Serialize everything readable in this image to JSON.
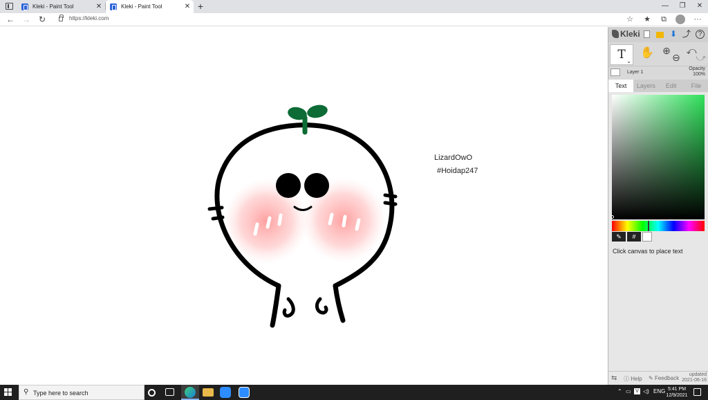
{
  "browser": {
    "tabs": [
      {
        "title": "Kleki - Paint Tool",
        "close": "✕"
      },
      {
        "title": "Kleki - Paint Tool",
        "close": "✕"
      }
    ],
    "new_tab": "+",
    "window_controls": [
      "—",
      "❐",
      "✕"
    ],
    "back": "←",
    "forward": "→",
    "reload": "↻",
    "url": "https://kleki.com",
    "toolbar_icons": [
      "add-favorite-icon",
      "favorites-icon",
      "collections-icon",
      "profile-icon",
      "more-icon"
    ],
    "more": "···"
  },
  "canvas": {
    "text_line_1": "LizardOwO",
    "text_line_2": "#Hoidap247"
  },
  "kleki_panel": {
    "logo": "Kleki",
    "text_tool": "T",
    "layer_name": "Layer 1",
    "opacity_label": "Opacity",
    "opacity_value": "100%",
    "tabs": [
      "Text",
      "Layers",
      "Edit",
      "File"
    ],
    "active_tab": "Text",
    "eyedropper": "✎",
    "hex_button": "#",
    "hint": "Click canvas to place text",
    "help": "Help",
    "feedback": "Feedback",
    "updated_label": "updated",
    "updated_date": "2021-06-16",
    "selected_color": "#ffffff"
  },
  "taskbar": {
    "search_placeholder": "Type here to search",
    "tray_lang": "ENG",
    "time": "5:41 PM",
    "date": "12/9/2021",
    "pinned": [
      "task-view-icon",
      "edge-icon",
      "file-explorer-icon",
      "zoom-icon",
      "zoom-icon"
    ]
  }
}
